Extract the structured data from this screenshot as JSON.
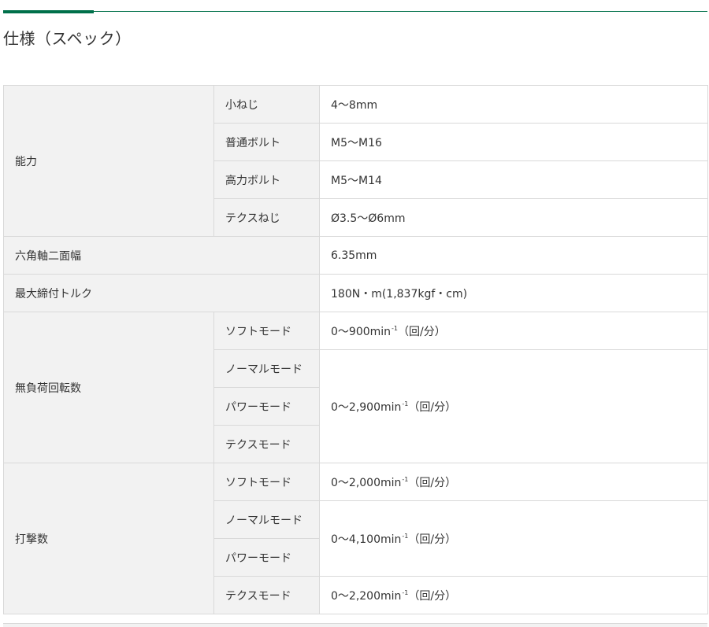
{
  "heading": "仕様（スペック）",
  "rows": {
    "capacity": {
      "label": "能力",
      "items": [
        {
          "label": "小ねじ",
          "value": "4～8mm"
        },
        {
          "label": "普通ボルト",
          "value": "M5～M16"
        },
        {
          "label": "高力ボルト",
          "value": "M5～M14"
        },
        {
          "label": "テクスねじ",
          "value": "Ø3.5～Ø6mm"
        }
      ]
    },
    "hex_shank": {
      "label": "六角軸二面幅",
      "value": "6.35mm"
    },
    "max_torque": {
      "label": "最大締付トルク",
      "value": "180N・m(1,837kgf・cm)"
    },
    "no_load_speed": {
      "label": "無負荷回転数",
      "modes": [
        "ソフトモード",
        "ノーマルモード",
        "パワーモード",
        "テクスモード"
      ],
      "values": [
        {
          "main": "0～900min",
          "sup": "-1",
          "unit": "（回/分）"
        },
        {
          "main": "0～2,900min",
          "sup": "-1",
          "unit": "（回/分）"
        }
      ]
    },
    "impact_rate": {
      "label": "打撃数",
      "modes": [
        "ソフトモード",
        "ノーマルモード",
        "パワーモード",
        "テクスモード"
      ],
      "values": [
        {
          "main": "0～2,000min",
          "sup": "-1",
          "unit": "（回/分）"
        },
        {
          "main": "0～4,100min",
          "sup": "-1",
          "unit": "（回/分）"
        },
        {
          "main": "0～2,200min",
          "sup": "-1",
          "unit": "（回/分）"
        }
      ]
    }
  },
  "colors": {
    "accent": "#00704a",
    "header_bg": "#f2f2f2",
    "border": "#d9d9d9",
    "text": "#333333"
  }
}
